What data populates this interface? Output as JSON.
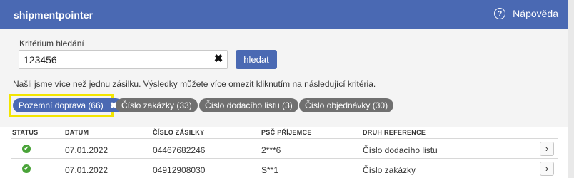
{
  "header": {
    "brand": "shipmentpointer",
    "help_label": "Nápověda",
    "help_icon": "?"
  },
  "search": {
    "label": "Kritérium hledání",
    "value": "123456",
    "clear_icon": "✖",
    "button_label": "hledat"
  },
  "info": "Našli jsme více než jednu zásilku. Výsledky můžete více omezit kliknutím na následující kritéria.",
  "filters": [
    {
      "label": "Pozemní doprava",
      "count": "(66)",
      "active": true,
      "remove_icon": "✖"
    },
    {
      "label": "Číslo zakázky",
      "count": "(33)",
      "active": false
    },
    {
      "label": "Číslo dodacího listu",
      "count": "(3)",
      "active": false
    },
    {
      "label": "Číslo objednávky",
      "count": "(30)",
      "active": false
    }
  ],
  "table": {
    "columns": [
      "STATUS",
      "DATUM",
      "ČÍSLO ZÁSILKY",
      "PSČ PŘÍJEMCE",
      "DRUH REFERENCE"
    ],
    "rows": [
      {
        "status_icon": "✔",
        "date": "07.01.2022",
        "shipment_no": "04467682246",
        "zip": "2***6",
        "reference_type": "Číslo dodacího listu",
        "open_icon": "›"
      },
      {
        "status_icon": "✔",
        "date": "07.01.2022",
        "shipment_no": "04912908030",
        "zip": "S**1",
        "reference_type": "Číslo zakázky",
        "open_icon": "›"
      }
    ]
  },
  "colors": {
    "brand": "#4a69b3",
    "chip_inactive": "#707070",
    "highlight": "#f2e500",
    "status_ok": "#49a338"
  }
}
